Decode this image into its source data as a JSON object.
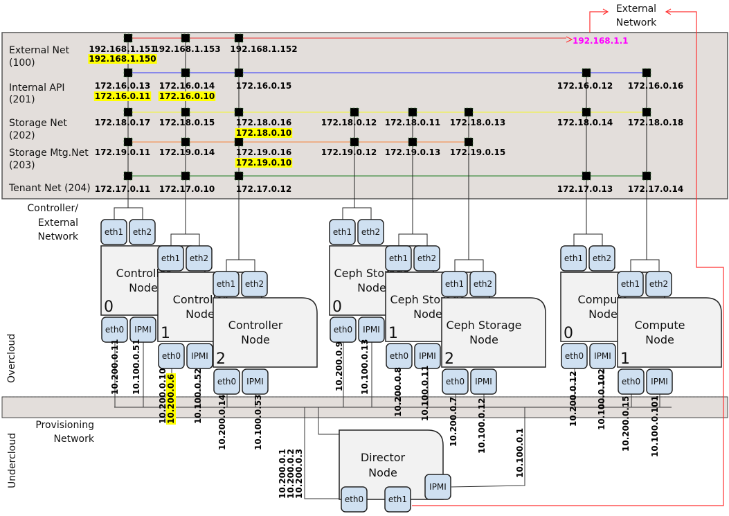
{
  "networks": [
    {
      "id": "external",
      "name": "External Net",
      "vlan": "(100)",
      "color": "#e86a6a"
    },
    {
      "id": "internal_api",
      "name": "Internal API",
      "vlan": "(201)",
      "color": "#6b6bf0"
    },
    {
      "id": "storage",
      "name": "Storage Net",
      "vlan": "(202)",
      "color": "#eeee66"
    },
    {
      "id": "storage_mgmt",
      "name": "Storage Mtg.Net",
      "vlan": "(203)",
      "color": "#f0a070"
    },
    {
      "id": "tenant",
      "name": "Tenant Net (204)",
      "vlan": "",
      "color": "#5a9a5a"
    }
  ],
  "controller_external_label": [
    "Controller/",
    "External",
    "Network"
  ],
  "overcloud_label": "Overcloud",
  "undercloud_label": "Undercloud",
  "provisioning_label": [
    "Provisioning",
    "Network"
  ],
  "external_network": {
    "label": [
      "External",
      "Network"
    ],
    "gateway": "192.168.1.1",
    "gateway_color": "#ff00ff",
    "link_color": "#ff3030"
  },
  "colors": {
    "panel": "#e3dedb",
    "node_fill": "#f2f2f2",
    "iface_fill": "#cfe0f1",
    "vip_highlight": "#ffff00"
  },
  "nodes": [
    {
      "id": "ctrl0",
      "label": [
        "Controller",
        "Node"
      ],
      "index": "0",
      "interfaces": [
        "eth1",
        "eth2",
        "eth0",
        "IPMI"
      ],
      "ips": {
        "external": "192.168.1.151",
        "internal_api": "172.16.0.13",
        "storage": "172.18.0.17",
        "storage_mgmt": "172.19.0.11",
        "tenant": "172.17.0.11",
        "provisioning": "10.200.0.11",
        "ipmi": "10.100.0.51"
      },
      "vips": {
        "external": "192.168.1.150",
        "internal_api": "172.16.0.11"
      }
    },
    {
      "id": "ctrl1",
      "label": [
        "Controller",
        "Node"
      ],
      "index": "1",
      "interfaces": [
        "eth1",
        "eth2",
        "eth0",
        "IPMI"
      ],
      "ips": {
        "external": "192.168.1.153",
        "internal_api": "172.16.0.14",
        "storage": "172.18.0.15",
        "storage_mgmt": "172.19.0.14",
        "tenant": "172.17.0.10",
        "provisioning": "10.200.0.10",
        "ipmi": "10.100.0.52"
      },
      "vips": {
        "internal_api": "172.16.0.10",
        "provisioning": "10.200.0.6"
      }
    },
    {
      "id": "ctrl2",
      "label": [
        "Controller",
        "Node"
      ],
      "index": "2",
      "interfaces": [
        "eth1",
        "eth2",
        "eth0",
        "IPMI"
      ],
      "ips": {
        "external": "192.168.1.152",
        "internal_api": "172.16.0.15",
        "storage": "172.18.0.16",
        "storage_mgmt": "172.19.0.16",
        "tenant": "172.17.0.12",
        "provisioning": "10.200.0.14",
        "ipmi": "10.100.0.53"
      },
      "vips": {
        "storage": "172.18.0.10",
        "storage_mgmt": "172.19.0.10"
      }
    },
    {
      "id": "ceph0",
      "label": [
        "Ceph Storage",
        "Node"
      ],
      "index": "0",
      "interfaces": [
        "eth1",
        "eth2",
        "eth0",
        "IPMI"
      ],
      "ips": {
        "storage": "172.18.0.12",
        "storage_mgmt": "172.19.0.12",
        "provisioning": "10.200.0.9",
        "ipmi": "10.100.0.13"
      },
      "vips": {}
    },
    {
      "id": "ceph1",
      "label": [
        "Ceph Storage",
        "Node"
      ],
      "index": "1",
      "interfaces": [
        "eth1",
        "eth2",
        "eth0",
        "IPMI"
      ],
      "ips": {
        "storage": "172.18.0.11",
        "storage_mgmt": "172.19.0.13",
        "provisioning": "10.200.0.8",
        "ipmi": "10.100.0.11"
      },
      "vips": {}
    },
    {
      "id": "ceph2",
      "label": [
        "Ceph Storage",
        "Node"
      ],
      "index": "2",
      "interfaces": [
        "eth1",
        "eth2",
        "eth0",
        "IPMI"
      ],
      "ips": {
        "storage": "172.18.0.13",
        "storage_mgmt": "172.19.0.15",
        "provisioning": "10.200.0.7",
        "ipmi": "10.100.0.12"
      },
      "vips": {}
    },
    {
      "id": "comp0",
      "label": [
        "Compute",
        "Node"
      ],
      "index": "0",
      "interfaces": [
        "eth1",
        "eth2",
        "eth0",
        "IPMI"
      ],
      "ips": {
        "internal_api": "172.16.0.12",
        "storage": "172.18.0.14",
        "tenant": "172.17.0.13",
        "provisioning": "10.200.0.12",
        "ipmi": "10.100.0.102"
      },
      "vips": {}
    },
    {
      "id": "comp1",
      "label": [
        "Compute",
        "Node"
      ],
      "index": "1",
      "interfaces": [
        "eth1",
        "eth2",
        "eth0",
        "IPMI"
      ],
      "ips": {
        "internal_api": "172.16.0.16",
        "storage": "172.18.0.18",
        "tenant": "172.17.0.14",
        "provisioning": "10.200.0.15",
        "ipmi": "10.100.0.101"
      },
      "vips": {}
    }
  ],
  "director": {
    "label": [
      "Director",
      "Node"
    ],
    "interfaces": [
      "eth0",
      "eth1",
      "IPMI"
    ],
    "provisioning_ips": [
      "10.200.0.1",
      "10.200.0.2",
      "10.200.0.3"
    ],
    "ipmi_ip": "10.100.0.1"
  }
}
